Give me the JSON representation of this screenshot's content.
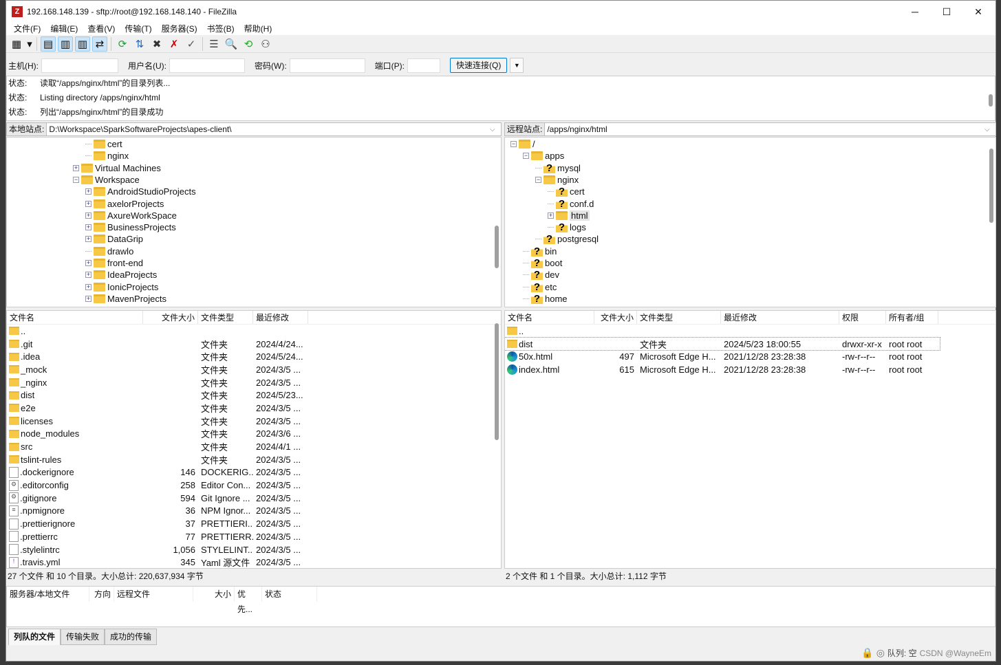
{
  "window": {
    "title": "192.168.148.139 - sftp://root@192.168.148.140 - FileZilla",
    "app_icon_text": "Z",
    "minimize": "─",
    "maximize": "☐",
    "close": "✕"
  },
  "menu": [
    "文件(F)",
    "编辑(E)",
    "查看(V)",
    "传输(T)",
    "服务器(S)",
    "书签(B)",
    "帮助(H)"
  ],
  "toolbar": [
    {
      "name": "site-manager-icon",
      "glyph": "▦"
    },
    {
      "name": "site-manager-dropdown-icon",
      "glyph": "▾"
    },
    {
      "name": "toggle-message-log-icon",
      "glyph": "▤",
      "on": true
    },
    {
      "name": "toggle-local-tree-icon",
      "glyph": "▥",
      "on": true
    },
    {
      "name": "toggle-remote-tree-icon",
      "glyph": "▥",
      "on": true
    },
    {
      "name": "toggle-transfer-queue-icon",
      "glyph": "⇄",
      "on": true
    },
    {
      "name": "refresh-icon",
      "glyph": "⟳",
      "color": "#1e9e3a"
    },
    {
      "name": "process-queue-icon",
      "glyph": "⇅",
      "color": "#2266bb"
    },
    {
      "name": "cancel-icon",
      "glyph": "✖",
      "color": "#333"
    },
    {
      "name": "disconnect-icon",
      "glyph": "✗",
      "color": "#c00"
    },
    {
      "name": "reconnect-icon",
      "glyph": "✓",
      "color": "#555"
    },
    {
      "name": "filter-icon",
      "glyph": "☰",
      "color": "#444"
    },
    {
      "name": "compare-icon",
      "glyph": "🔍"
    },
    {
      "name": "sync-browse-icon",
      "glyph": "⟲",
      "color": "#2a2"
    },
    {
      "name": "search-icon",
      "glyph": "⚇",
      "color": "#333"
    }
  ],
  "quickconnect": {
    "host_label": "主机(H):",
    "user_label": "用户名(U):",
    "pass_label": "密码(W):",
    "port_label": "端口(P):",
    "host": "",
    "user": "",
    "pass": "",
    "port": "",
    "button": "快速连接(Q)"
  },
  "log": [
    {
      "k": "状态:",
      "v": "读取“/apps/nginx/html”的目录列表..."
    },
    {
      "k": "状态:",
      "v": "Listing directory /apps/nginx/html"
    },
    {
      "k": "状态:",
      "v": "列出“/apps/nginx/html”的目录成功"
    }
  ],
  "local": {
    "site_label": "本地站点:",
    "path": "D:\\Workspace\\SparkSoftwareProjects\\apes-client\\",
    "tree": [
      {
        "label": "cert",
        "level": 3,
        "exp": "",
        "icon": "folder"
      },
      {
        "label": "nginx",
        "level": 3,
        "exp": "",
        "icon": "folder"
      },
      {
        "label": "Virtual Machines",
        "level": 2,
        "exp": "+",
        "icon": "folder"
      },
      {
        "label": "Workspace",
        "level": 2,
        "exp": "-",
        "icon": "folder"
      },
      {
        "label": "AndroidStudioProjects",
        "level": 3,
        "exp": "+",
        "icon": "folder"
      },
      {
        "label": "axelorProjects",
        "level": 3,
        "exp": "+",
        "icon": "folder"
      },
      {
        "label": "AxureWorkSpace",
        "level": 3,
        "exp": "+",
        "icon": "folder"
      },
      {
        "label": "BusinessProjects",
        "level": 3,
        "exp": "+",
        "icon": "folder"
      },
      {
        "label": "DataGrip",
        "level": 3,
        "exp": "+",
        "icon": "folder"
      },
      {
        "label": "drawlo",
        "level": 3,
        "exp": "",
        "icon": "folder"
      },
      {
        "label": "front-end",
        "level": 3,
        "exp": "+",
        "icon": "folder"
      },
      {
        "label": "IdeaProjects",
        "level": 3,
        "exp": "+",
        "icon": "folder"
      },
      {
        "label": "IonicProjects",
        "level": 3,
        "exp": "+",
        "icon": "folder"
      },
      {
        "label": "MavenProjects",
        "level": 3,
        "exp": "+",
        "icon": "folder"
      }
    ],
    "columns": [
      "文件名",
      "文件大小",
      "文件类型",
      "最近修改"
    ],
    "files": [
      {
        "name": "..",
        "size": "",
        "type": "",
        "mod": "",
        "icon": "folder"
      },
      {
        "name": ".git",
        "size": "",
        "type": "文件夹",
        "mod": "2024/4/24...",
        "icon": "folder"
      },
      {
        "name": ".idea",
        "size": "",
        "type": "文件夹",
        "mod": "2024/5/24...",
        "icon": "folder"
      },
      {
        "name": "_mock",
        "size": "",
        "type": "文件夹",
        "mod": "2024/3/5 ...",
        "icon": "folder"
      },
      {
        "name": "_nginx",
        "size": "",
        "type": "文件夹",
        "mod": "2024/3/5 ...",
        "icon": "folder"
      },
      {
        "name": "dist",
        "size": "",
        "type": "文件夹",
        "mod": "2024/5/23...",
        "icon": "folder"
      },
      {
        "name": "e2e",
        "size": "",
        "type": "文件夹",
        "mod": "2024/3/5 ...",
        "icon": "folder"
      },
      {
        "name": "licenses",
        "size": "",
        "type": "文件夹",
        "mod": "2024/3/5 ...",
        "icon": "folder"
      },
      {
        "name": "node_modules",
        "size": "",
        "type": "文件夹",
        "mod": "2024/3/6 ...",
        "icon": "folder"
      },
      {
        "name": "src",
        "size": "",
        "type": "文件夹",
        "mod": "2024/4/1 ...",
        "icon": "folder"
      },
      {
        "name": "tslint-rules",
        "size": "",
        "type": "文件夹",
        "mod": "2024/3/5 ...",
        "icon": "folder"
      },
      {
        "name": ".dockerignore",
        "size": "146",
        "type": "DOCKERIG...",
        "mod": "2024/3/5 ...",
        "icon": "file"
      },
      {
        "name": ".editorconfig",
        "size": "258",
        "type": "Editor Con...",
        "mod": "2024/3/5 ...",
        "icon": "config"
      },
      {
        "name": ".gitignore",
        "size": "594",
        "type": "Git Ignore ...",
        "mod": "2024/3/5 ...",
        "icon": "config"
      },
      {
        "name": ".npmignore",
        "size": "36",
        "type": "NPM Ignor...",
        "mod": "2024/3/5 ...",
        "icon": "text"
      },
      {
        "name": ".prettierignore",
        "size": "37",
        "type": "PRETTIERI...",
        "mod": "2024/3/5 ...",
        "icon": "file"
      },
      {
        "name": ".prettierrc",
        "size": "77",
        "type": "PRETTIERR...",
        "mod": "2024/3/5 ...",
        "icon": "file"
      },
      {
        "name": ".stylelintrc",
        "size": "1,056",
        "type": "STYLELINT...",
        "mod": "2024/3/5 ...",
        "icon": "file"
      },
      {
        "name": ".travis.yml",
        "size": "345",
        "type": "Yaml 源文件",
        "mod": "2024/3/5 ...",
        "icon": "yaml"
      }
    ],
    "summary": "27 个文件 和 10 个目录。大小总计: 220,637,934 字节"
  },
  "remote": {
    "site_label": "远程站点:",
    "path": "/apps/nginx/html",
    "tree": [
      {
        "label": "/",
        "level": 0,
        "exp": "-",
        "icon": "folder"
      },
      {
        "label": "apps",
        "level": 1,
        "exp": "-",
        "icon": "folder"
      },
      {
        "label": "mysql",
        "level": 2,
        "exp": "",
        "icon": "unknown"
      },
      {
        "label": "nginx",
        "level": 2,
        "exp": "-",
        "icon": "folder"
      },
      {
        "label": "cert",
        "level": 3,
        "exp": "",
        "icon": "unknown"
      },
      {
        "label": "conf.d",
        "level": 3,
        "exp": "",
        "icon": "unknown"
      },
      {
        "label": "html",
        "level": 3,
        "exp": "+",
        "icon": "folder",
        "selected": true
      },
      {
        "label": "logs",
        "level": 3,
        "exp": "",
        "icon": "unknown"
      },
      {
        "label": "postgresql",
        "level": 2,
        "exp": "",
        "icon": "unknown"
      },
      {
        "label": "bin",
        "level": 1,
        "exp": "",
        "icon": "unknown"
      },
      {
        "label": "boot",
        "level": 1,
        "exp": "",
        "icon": "unknown"
      },
      {
        "label": "dev",
        "level": 1,
        "exp": "",
        "icon": "unknown"
      },
      {
        "label": "etc",
        "level": 1,
        "exp": "",
        "icon": "unknown"
      },
      {
        "label": "home",
        "level": 1,
        "exp": "",
        "icon": "unknown"
      }
    ],
    "columns": [
      "文件名",
      "文件大小",
      "文件类型",
      "最近修改",
      "权限",
      "所有者/组"
    ],
    "files": [
      {
        "name": "..",
        "size": "",
        "type": "",
        "mod": "",
        "perm": "",
        "owner": "",
        "icon": "folder"
      },
      {
        "name": "dist",
        "size": "",
        "type": "文件夹",
        "mod": "2024/5/23 18:00:55",
        "perm": "drwxr-xr-x",
        "owner": "root root",
        "icon": "folder",
        "focused": true
      },
      {
        "name": "50x.html",
        "size": "497",
        "type": "Microsoft Edge H...",
        "mod": "2021/12/28 23:28:38",
        "perm": "-rw-r--r--",
        "owner": "root root",
        "icon": "edge"
      },
      {
        "name": "index.html",
        "size": "615",
        "type": "Microsoft Edge H...",
        "mod": "2021/12/28 23:28:38",
        "perm": "-rw-r--r--",
        "owner": "root root",
        "icon": "edge"
      }
    ],
    "summary": "2 个文件 和 1 个目录。大小总计: 1,112 字节"
  },
  "queue": {
    "columns": [
      "服务器/本地文件",
      "方向",
      "远程文件",
      "大小",
      "优先...",
      "状态"
    ],
    "tabs": [
      {
        "label": "列队的文件",
        "active": true
      },
      {
        "label": "传输失败"
      },
      {
        "label": "成功的传输"
      }
    ]
  },
  "statusbar": {
    "queue": "队列: 空",
    "watermark": "CSDN @WayneEm"
  }
}
